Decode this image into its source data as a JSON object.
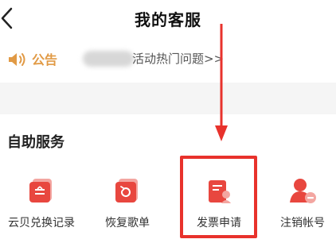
{
  "header": {
    "title": "我的客服"
  },
  "notice": {
    "label": "公告",
    "text": "活动热门问题>>"
  },
  "self_service": {
    "title": "自助服务",
    "items": [
      {
        "label": "云贝兑换记录",
        "icon": "exchange-record-icon"
      },
      {
        "label": "恢复歌单",
        "icon": "restore-playlist-icon"
      },
      {
        "label": "发票申请",
        "icon": "invoice-icon"
      },
      {
        "label": "注销帐号",
        "icon": "cancel-account-icon"
      }
    ]
  },
  "colors": {
    "accent": "#e8322c",
    "notice": "#e19a45"
  }
}
